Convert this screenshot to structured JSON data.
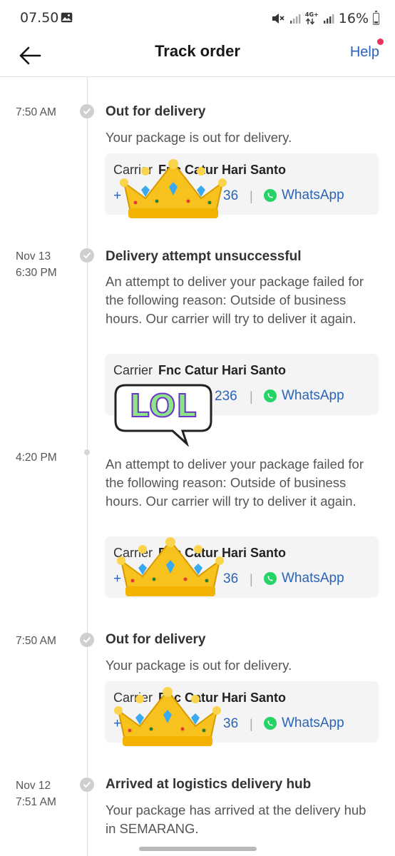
{
  "status_bar": {
    "time": "07.50",
    "network_label_top": "4G+",
    "battery": "16%"
  },
  "header": {
    "title": "Track order",
    "help_label": "Help"
  },
  "colors": {
    "link": "#2a64b8",
    "notification_dot": "#e8335a",
    "whatsapp": "#25d366"
  },
  "events": [
    {
      "time": "7:50 AM",
      "title": "Out for delivery",
      "description": "Your package is out for delivery.",
      "carrier": {
        "label": "Carrier",
        "name": "Fnc Catur Hari Santo",
        "phone": "+",
        "phone_tail": "36",
        "whatsapp": "WhatsApp"
      }
    },
    {
      "date": "Nov 13",
      "time": "6:30 PM",
      "title": "Delivery attempt unsuccessful",
      "description": "An attempt to deliver your package failed for the following reason: Outside of business hours. Our carrier will try to deliver it again.",
      "carrier": {
        "label": "Carrier",
        "name": "Fnc Catur Hari Santo",
        "phone_tail": "236",
        "whatsapp": "WhatsApp"
      }
    },
    {
      "time": "4:20 PM",
      "description": "An attempt to deliver your package failed for the following reason: Outside of business hours. Our carrier will try to deliver it again.",
      "carrier": {
        "label": "Carrier",
        "name": "Fnc Catur Hari Santo",
        "phone": "+",
        "phone_tail": "36",
        "whatsapp": "WhatsApp"
      }
    },
    {
      "time": "7:50 AM",
      "title": "Out for delivery",
      "description": "Your package is out for delivery.",
      "carrier": {
        "label": "Carrier",
        "name": "Fnc Catur Hari Santo",
        "phone": "+",
        "phone_tail": "36",
        "whatsapp": "WhatsApp"
      }
    },
    {
      "date": "Nov 12",
      "time": "7:51 AM",
      "title": "Arrived at logistics delivery hub",
      "description": "Your package has arrived at the delivery hub in SEMARANG."
    }
  ],
  "stickers": {
    "lol_text": "LOL",
    "crown_icon": "crown-sticker"
  }
}
